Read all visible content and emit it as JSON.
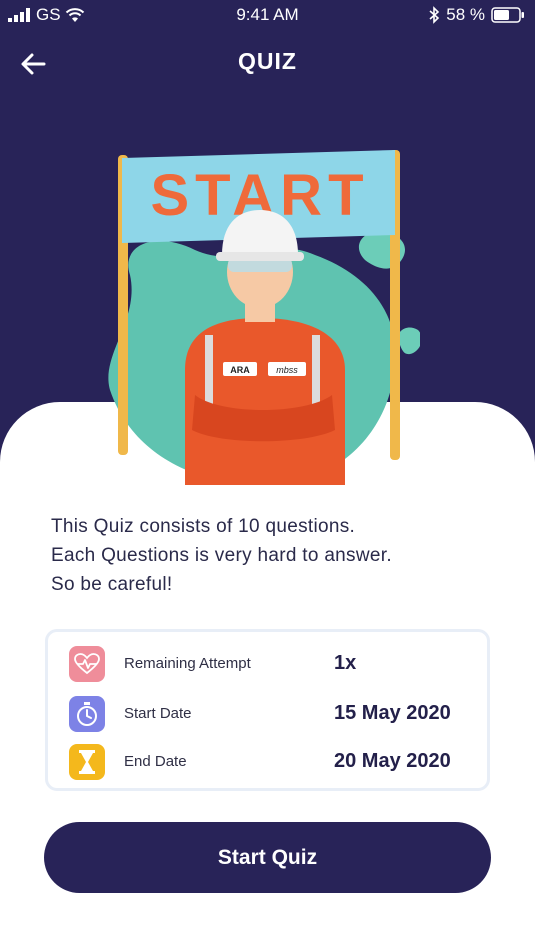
{
  "status_bar": {
    "carrier": "GS",
    "time": "9:41 AM",
    "battery": "58 %"
  },
  "header": {
    "title": "QUIZ"
  },
  "illustration": {
    "banner_text": "START",
    "badge_left": "ARA",
    "badge_right": "mbss"
  },
  "description": {
    "lines": [
      "This Quiz consists of 10 questions.",
      "Each Questions is very hard to answer.",
      "So be careful!"
    ]
  },
  "info": {
    "rows": [
      {
        "label": "Remaining Attempt",
        "value": "1x",
        "icon": "heart-pulse-icon",
        "icon_bg": "#ef8d9a"
      },
      {
        "label": "Start Date",
        "value": "15 May 2020",
        "icon": "stopwatch-icon",
        "icon_bg": "#7d82e6"
      },
      {
        "label": "End Date",
        "value": "20 May 2020",
        "icon": "hourglass-icon",
        "icon_bg": "#f4b81c"
      }
    ]
  },
  "actions": {
    "start_label": "Start Quiz"
  },
  "colors": {
    "primary": "#282358",
    "accent_teal": "#5fc3b0",
    "accent_orange": "#e9582b"
  }
}
